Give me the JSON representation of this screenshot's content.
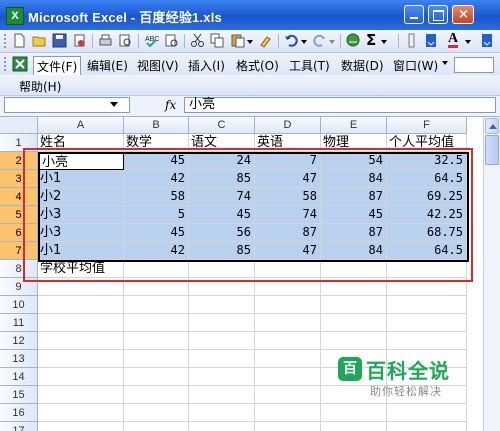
{
  "window": {
    "title": "Microsoft Excel - 百度经验1.xls",
    "app_icon": "X"
  },
  "menu": {
    "items": [
      "文件(F)",
      "编辑(E)",
      "视图(V)",
      "插入(I)",
      "格式(O)",
      "工具(T)",
      "数据(D)",
      "窗口(W)"
    ],
    "help": "帮助(H)"
  },
  "toolbar": {
    "sigma": "Σ"
  },
  "formula_bar": {
    "name_box": "",
    "fx": "fx",
    "value": "小亮"
  },
  "columns": [
    "A",
    "B",
    "C",
    "D",
    "E",
    "F"
  ],
  "rows": [
    "1",
    "2",
    "3",
    "4",
    "5",
    "6",
    "7",
    "8",
    "9",
    "10",
    "11",
    "12",
    "13",
    "14",
    "15",
    "16",
    "17"
  ],
  "table": {
    "header": [
      "姓名",
      "数学",
      "语文",
      "英语",
      "物理",
      "个人平均值"
    ],
    "data": [
      [
        "小亮",
        "45",
        "24",
        "7",
        "54",
        "32.5"
      ],
      [
        "小1",
        "42",
        "85",
        "47",
        "84",
        "64.5"
      ],
      [
        "小2",
        "58",
        "74",
        "58",
        "87",
        "69.25"
      ],
      [
        "小3",
        "5",
        "45",
        "74",
        "45",
        "42.25"
      ],
      [
        "小3",
        "45",
        "56",
        "87",
        "87",
        "68.75"
      ],
      [
        "小1",
        "42",
        "85",
        "47",
        "84",
        "64.5"
      ]
    ],
    "footer_label": "学校平均值"
  },
  "watermark": {
    "main": "百科全说",
    "sub": "助你轻松解决",
    "logo": "百"
  },
  "colors": {
    "highlight": "#b9d1ef",
    "annotation_box": "#e1262c",
    "selected_row_header": "#fbc36c"
  }
}
